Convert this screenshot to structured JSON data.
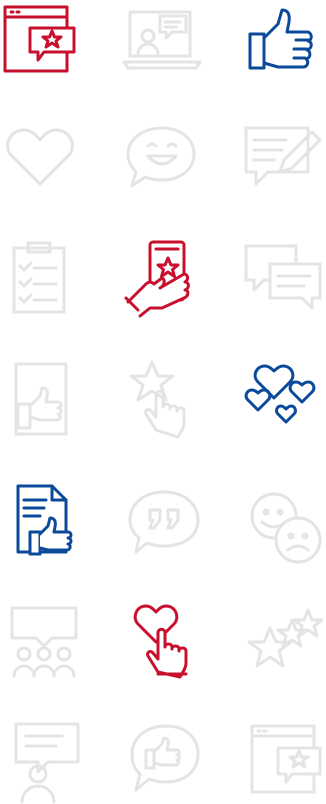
{
  "colors": {
    "red": "#c8102e",
    "blue": "#0b4a9a",
    "gray": "#e4e4e4",
    "background": "#ffffff"
  },
  "icons": [
    {
      "name": "browser-review-star-icon",
      "tone": "red"
    },
    {
      "name": "laptop-video-chat-icon",
      "tone": "gray"
    },
    {
      "name": "thumbs-up-icon",
      "tone": "blue"
    },
    {
      "name": "heart-icon",
      "tone": "gray"
    },
    {
      "name": "smile-speech-bubble-icon",
      "tone": "gray"
    },
    {
      "name": "write-feedback-icon",
      "tone": "gray"
    },
    {
      "name": "checklist-clipboard-icon",
      "tone": "gray"
    },
    {
      "name": "phone-rating-star-icon",
      "tone": "red"
    },
    {
      "name": "chat-bubbles-icon",
      "tone": "gray"
    },
    {
      "name": "thumbs-up-frame-icon",
      "tone": "gray"
    },
    {
      "name": "star-tap-icon",
      "tone": "gray"
    },
    {
      "name": "hearts-icon",
      "tone": "blue"
    },
    {
      "name": "document-thumbs-up-icon",
      "tone": "blue"
    },
    {
      "name": "quote-bubble-icon",
      "tone": "gray"
    },
    {
      "name": "happy-sad-faces-icon",
      "tone": "gray"
    },
    {
      "name": "group-discussion-icon",
      "tone": "gray"
    },
    {
      "name": "heart-tap-icon",
      "tone": "red"
    },
    {
      "name": "stars-rating-icon",
      "tone": "gray"
    },
    {
      "name": "presenter-icon",
      "tone": "gray"
    },
    {
      "name": "like-bubble-icon",
      "tone": "gray"
    },
    {
      "name": "web-rating-icon",
      "tone": "gray"
    }
  ]
}
